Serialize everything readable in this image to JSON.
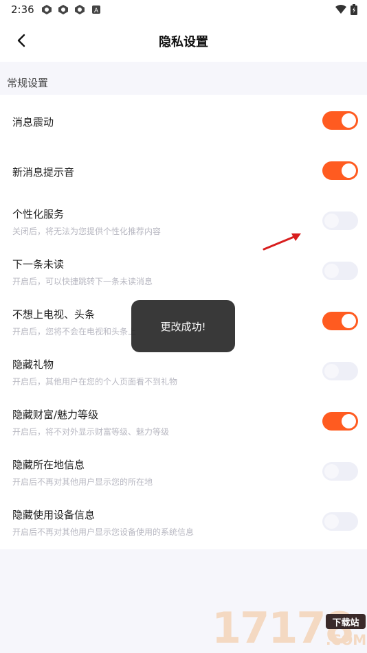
{
  "status_bar": {
    "time": "2:36",
    "notification_icons": [
      "app-icon",
      "app-icon",
      "app-icon",
      "a-icon"
    ],
    "right_icons": [
      "wifi-icon",
      "battery-icon"
    ]
  },
  "header": {
    "title": "隐私设置"
  },
  "section": {
    "label": "常规设置"
  },
  "settings": [
    {
      "title": "消息震动",
      "subtitle": "",
      "enabled": true
    },
    {
      "title": "新消息提示音",
      "subtitle": "",
      "enabled": true
    },
    {
      "title": "个性化服务",
      "subtitle": "关闭后，将无法为您提供个性化推荐内容",
      "enabled": false
    },
    {
      "title": "下一条未读",
      "subtitle": "开启后，可以快捷跳转下一条未读消息",
      "enabled": false
    },
    {
      "title": "不想上电视、头条",
      "subtitle": "开启后，您将不会在电视和头条上",
      "enabled": true
    },
    {
      "title": "隐藏礼物",
      "subtitle": "开启后，其他用户在您的个人页面看不到礼物",
      "enabled": false
    },
    {
      "title": "隐藏财富/魅力等级",
      "subtitle": "开启后，将不对外显示财富等级、魅力等级",
      "enabled": true
    },
    {
      "title": "隐藏所在地信息",
      "subtitle": "开启后不再对其他用户显示您的所在地",
      "enabled": false
    },
    {
      "title": "隐藏使用设备信息",
      "subtitle": "开启后不再对其他用户显示您设备使用的系统信息",
      "enabled": false
    }
  ],
  "toast": {
    "message": "更改成功!"
  },
  "watermark": {
    "number": "17178",
    "badge": "下载站",
    "domain": ".COM"
  },
  "colors": {
    "accent": "#ff5b20",
    "toggle_off": "#eeeff7",
    "background": "#f6f6fb"
  }
}
